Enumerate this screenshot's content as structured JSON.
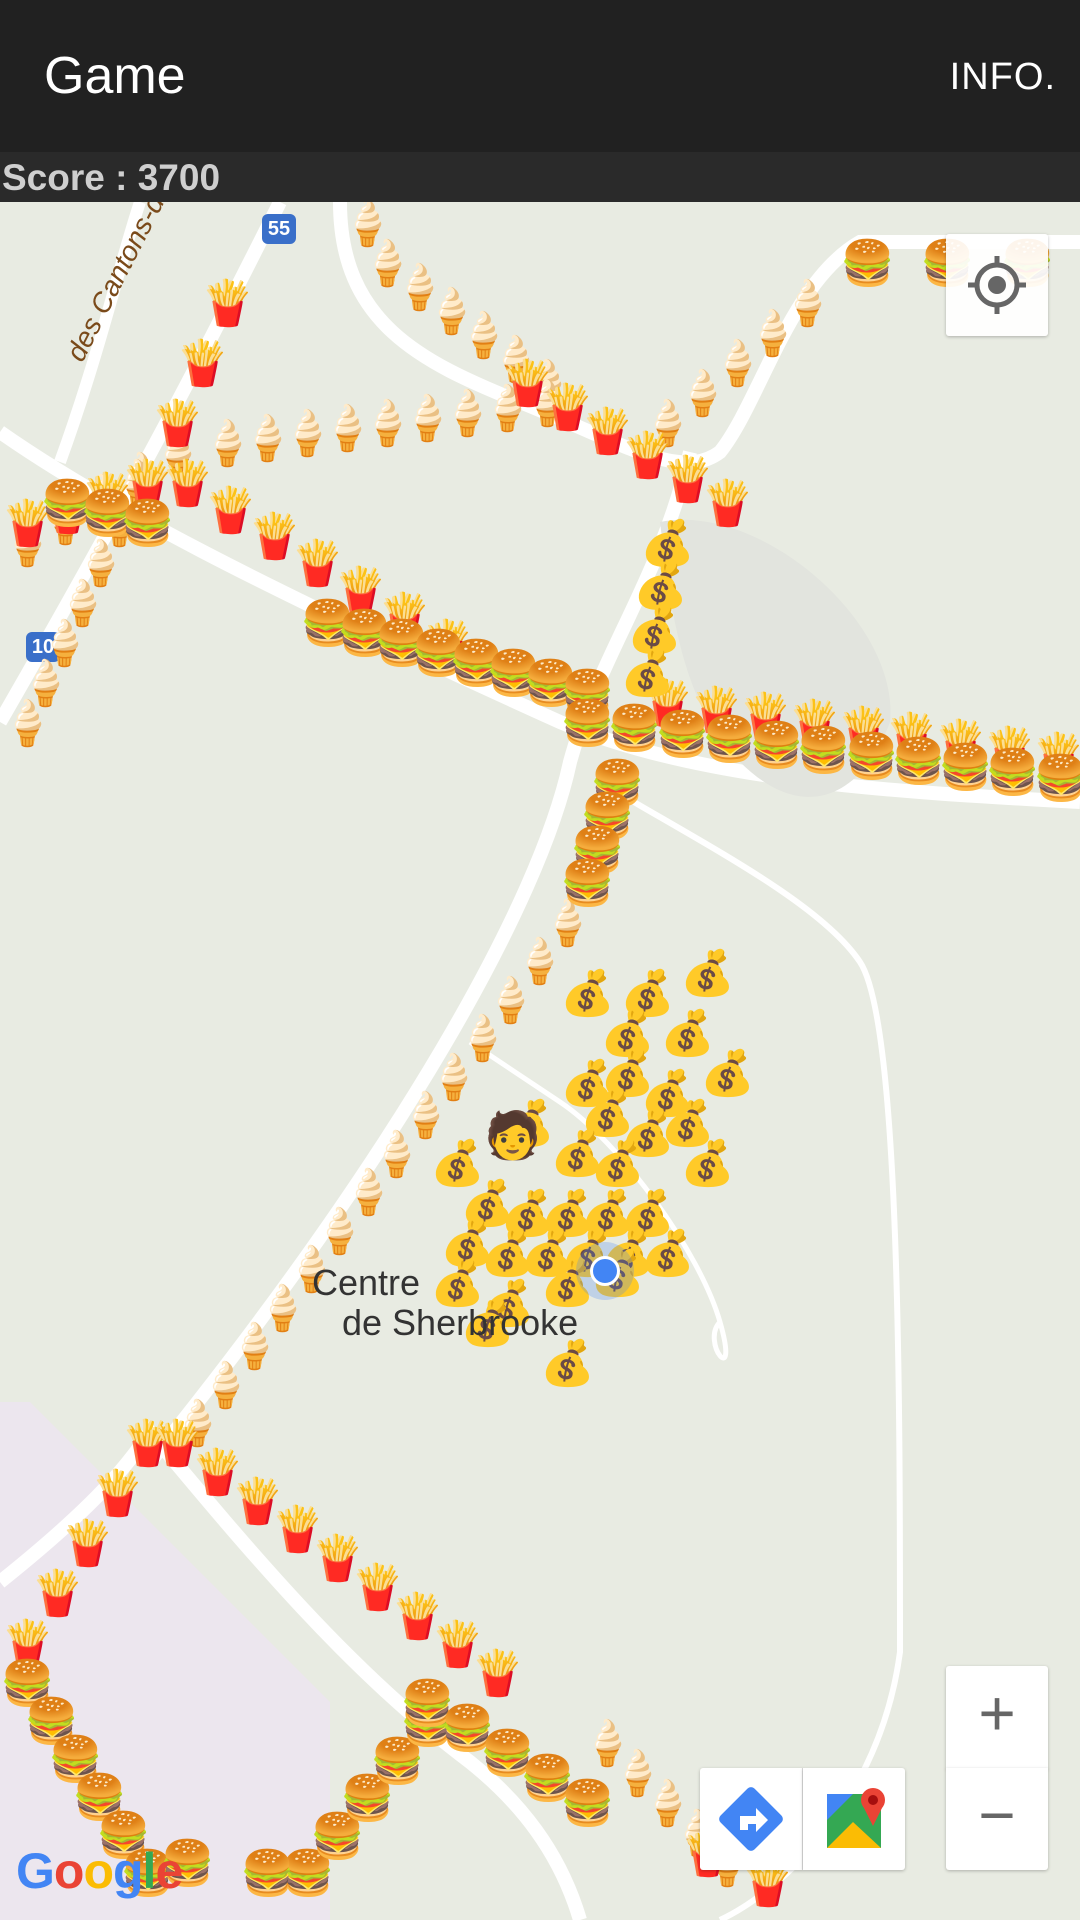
{
  "app": {
    "title": "Game",
    "info_label": "INFO."
  },
  "score": {
    "text": "Score : 3700",
    "value": 3700
  },
  "map": {
    "poi_line1": "Centre",
    "poi_line2": "de Sherbrooke",
    "road_label": "des Cantons-de-l'Est",
    "shield_55": "55",
    "shield_10": "10",
    "google_logo": "Google",
    "zoom_in": "+",
    "zoom_out": "−"
  },
  "icons": {
    "fries": "fries-icon",
    "burger": "burger-icon",
    "ice_cream": "ice-cream-icon",
    "money_bag": "money-bag-icon",
    "player": "player-avatar-icon",
    "my_location": "my-location-icon",
    "directions": "directions-icon",
    "google_maps": "google-maps-icon"
  },
  "colors": {
    "appbar": "#212121",
    "map_bg": "#e8ebe2",
    "road": "#ffffff",
    "location_blue": "#4285f4"
  }
}
